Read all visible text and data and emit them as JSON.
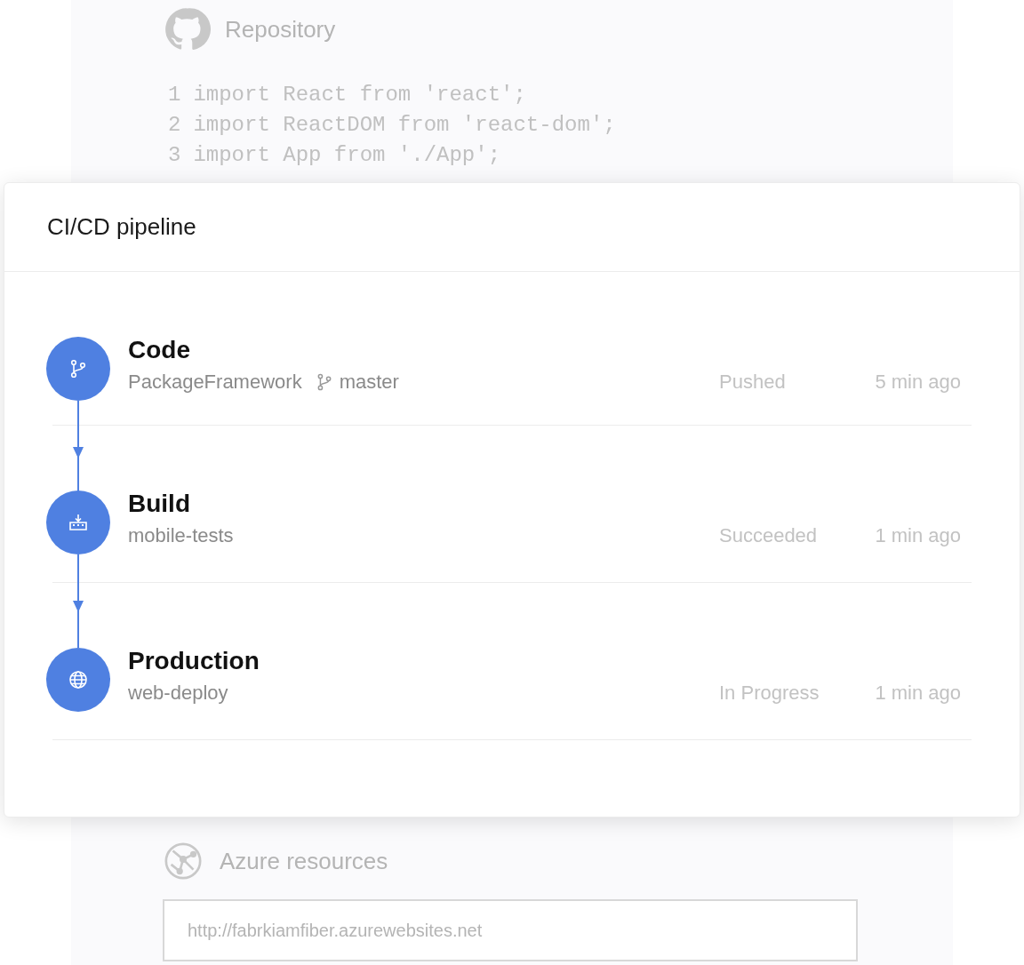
{
  "repository": {
    "title": "Repository",
    "code_lines": [
      {
        "number": "1",
        "text": "import React from 'react';"
      },
      {
        "number": "2",
        "text": "import ReactDOM from 'react-dom';"
      },
      {
        "number": "3",
        "text": "import App from './App';"
      }
    ]
  },
  "pipeline": {
    "title": "CI/CD pipeline",
    "steps": [
      {
        "kind": "code",
        "name": "Code",
        "source": "PackageFramework",
        "branch": "master",
        "status": "Pushed",
        "time": "5 min ago"
      },
      {
        "kind": "build",
        "name": "Build",
        "source": "mobile-tests",
        "status": "Succeeded",
        "time": "1 min ago"
      },
      {
        "kind": "deploy",
        "name": "Production",
        "source": "web-deploy",
        "status": "In Progress",
        "time": "1 min ago"
      }
    ]
  },
  "azure": {
    "title": "Azure resources",
    "url": "http://fabrkiamfiber.azurewebsites.net"
  }
}
